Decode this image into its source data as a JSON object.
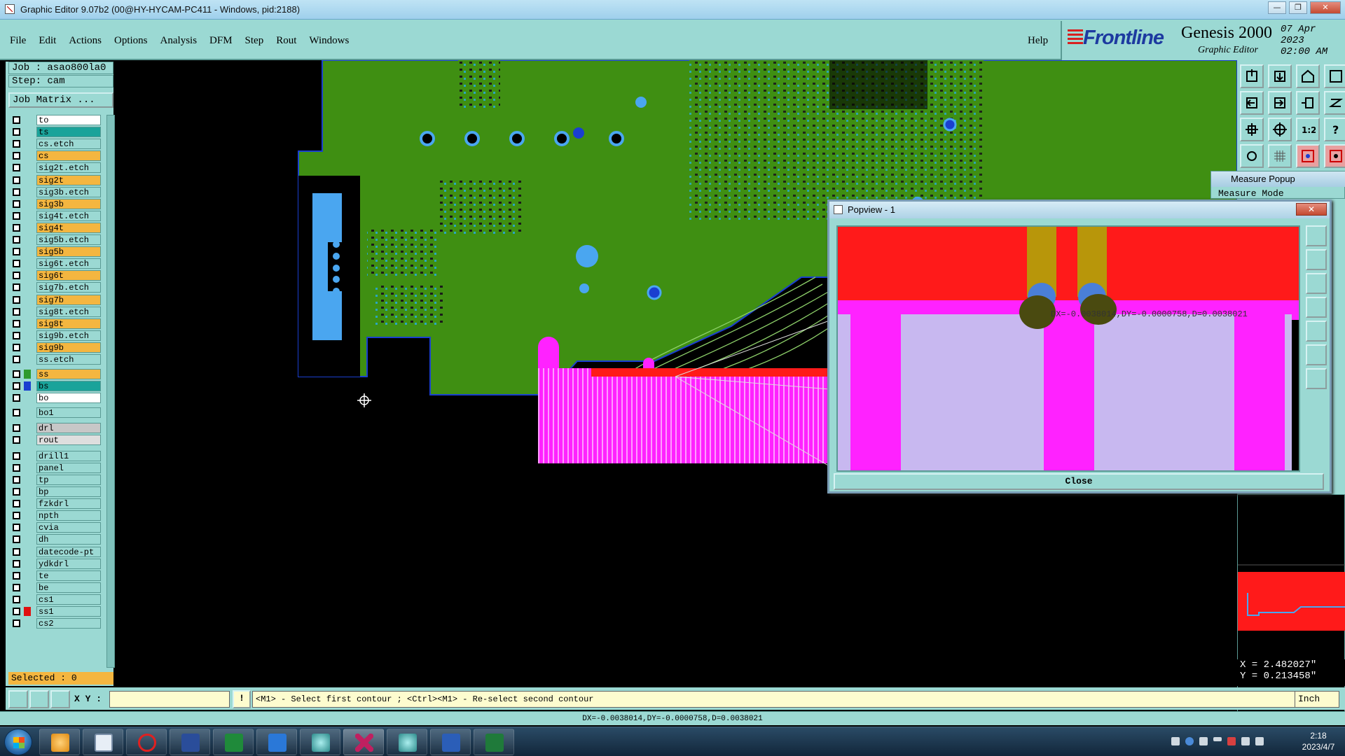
{
  "window": {
    "title": "Graphic Editor 9.07b2 (00@HY-HYCAM-PC411 - Windows, pid:2188)",
    "buttons": [
      "—",
      "❐",
      "✕"
    ]
  },
  "menu": {
    "items": [
      "File",
      "Edit",
      "Actions",
      "Options",
      "Analysis",
      "DFM",
      "Step",
      "Rout",
      "Windows"
    ],
    "help": "Help"
  },
  "brand": {
    "logo": "Frontline",
    "product": "Genesis 2000",
    "subtitle": "Graphic Editor",
    "date": "07 Apr 2023",
    "time": "02:00 AM"
  },
  "left_panel": {
    "job": "Job : asao800la0",
    "step": "Step: cam",
    "job_matrix": "Job Matrix ...",
    "selected": "Selected : 0",
    "layers": [
      {
        "name": "to",
        "color": "#ffffff",
        "swatch": ""
      },
      {
        "name": "ts",
        "color": "#1aa39a",
        "swatch": ""
      },
      {
        "name": "cs.etch",
        "color": "#9bd9d3",
        "swatch": ""
      },
      {
        "name": "cs",
        "color": "#f4b640",
        "swatch": ""
      },
      {
        "name": "sig2t.etch",
        "color": "#9bd9d3",
        "swatch": ""
      },
      {
        "name": "sig2t",
        "color": "#f4b640",
        "swatch": ""
      },
      {
        "name": "sig3b.etch",
        "color": "#9bd9d3",
        "swatch": ""
      },
      {
        "name": "sig3b",
        "color": "#f4b640",
        "swatch": ""
      },
      {
        "name": "sig4t.etch",
        "color": "#9bd9d3",
        "swatch": ""
      },
      {
        "name": "sig4t",
        "color": "#f4b640",
        "swatch": ""
      },
      {
        "name": "sig5b.etch",
        "color": "#9bd9d3",
        "swatch": ""
      },
      {
        "name": "sig5b",
        "color": "#f4b640",
        "swatch": ""
      },
      {
        "name": "sig6t.etch",
        "color": "#9bd9d3",
        "swatch": ""
      },
      {
        "name": "sig6t",
        "color": "#f4b640",
        "swatch": ""
      },
      {
        "name": "sig7b.etch",
        "color": "#9bd9d3",
        "swatch": ""
      },
      {
        "name": "sig7b",
        "color": "#f4b640",
        "swatch": ""
      },
      {
        "name": "sig8t.etch",
        "color": "#9bd9d3",
        "swatch": ""
      },
      {
        "name": "sig8t",
        "color": "#f4b640",
        "swatch": ""
      },
      {
        "name": "sig9b.etch",
        "color": "#9bd9d3",
        "swatch": ""
      },
      {
        "name": "sig9b",
        "color": "#f4b640",
        "swatch": ""
      },
      {
        "name": "ss.etch",
        "color": "#9bd9d3",
        "swatch": ""
      },
      {
        "name": "ss",
        "color": "#f4b640",
        "swatch": "#2e9a2e"
      },
      {
        "name": "bs",
        "color": "#1aa39a",
        "swatch": "#1a3fd0"
      },
      {
        "name": "bo",
        "color": "#ffffff",
        "swatch": ""
      },
      {
        "name": "bo1",
        "color": "#9bd9d3",
        "swatch": ""
      },
      {
        "name": "drl",
        "color": "#c7c7c7",
        "swatch": ""
      },
      {
        "name": "rout",
        "color": "#dedede",
        "swatch": ""
      },
      {
        "name": "drill1",
        "color": "#9bd9d3",
        "swatch": ""
      },
      {
        "name": "panel",
        "color": "#9bd9d3",
        "swatch": ""
      },
      {
        "name": "tp",
        "color": "#9bd9d3",
        "swatch": ""
      },
      {
        "name": "bp",
        "color": "#9bd9d3",
        "swatch": ""
      },
      {
        "name": "fzkdrl",
        "color": "#9bd9d3",
        "swatch": ""
      },
      {
        "name": "npth",
        "color": "#9bd9d3",
        "swatch": ""
      },
      {
        "name": "cvia",
        "color": "#9bd9d3",
        "swatch": ""
      },
      {
        "name": "dh",
        "color": "#9bd9d3",
        "swatch": ""
      },
      {
        "name": "datecode-pt",
        "color": "#9bd9d3",
        "swatch": ""
      },
      {
        "name": "ydkdrl",
        "color": "#9bd9d3",
        "swatch": ""
      },
      {
        "name": "te",
        "color": "#9bd9d3",
        "swatch": ""
      },
      {
        "name": "be",
        "color": "#9bd9d3",
        "swatch": ""
      },
      {
        "name": "cs1",
        "color": "#9bd9d3",
        "swatch": ""
      },
      {
        "name": "ss1",
        "color": "#9bd9d3",
        "swatch": "#e01010"
      },
      {
        "name": "cs2",
        "color": "#9bd9d3",
        "swatch": ""
      }
    ]
  },
  "measure_popup": {
    "title": "Measure Popup",
    "mode": "Measure Mode"
  },
  "popview": {
    "title": "Popview - 1",
    "close_x": "✕",
    "close_button": "Close",
    "overlay": "DX=-0.0038014,DY=-0.0000758,D=0.0038021"
  },
  "coords": {
    "x": "X = 2.482027\"",
    "y": "Y = 0.213458\""
  },
  "command_bar": {
    "xy_label": "X Y :",
    "xy_value": "",
    "xy_button": "!",
    "prompt": "<M1> - Select first contour ; <Ctrl><M1> - Re-select second contour",
    "unit": "Inch"
  },
  "measure_result": "DX=-0.0038014,DY=-0.0000758,D=0.0038021",
  "taskbar": {
    "time": "2:18",
    "date": "2023/4/7"
  },
  "colors": {
    "panel": "#9bd9d3",
    "board_green": "#3f8f12",
    "pad_blue": "#4aa6f0",
    "magenta": "#ff22ff",
    "red": "#ff1a1a",
    "gold": "#b8960a",
    "lavender": "#c8b8f0"
  }
}
